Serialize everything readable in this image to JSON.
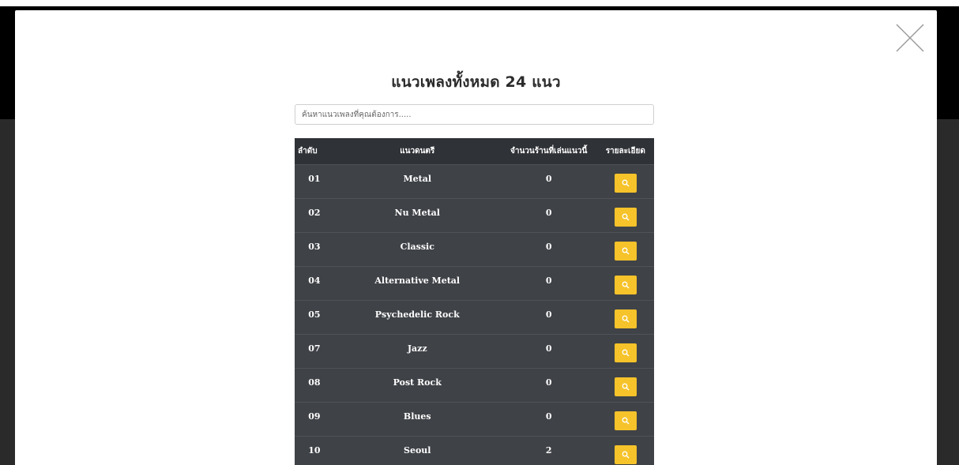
{
  "modal": {
    "title": "แนวเพลงทั้งหมด 24 แนว",
    "search_placeholder": "ค้นหาแนวเพลงที่คุณต้องการ.....",
    "close_icon": "close-icon"
  },
  "table": {
    "headers": {
      "no": "ลำดับ",
      "genre": "แนวดนตรี",
      "count": "จำนวนร้านที่เล่นแนวนี้",
      "detail": "รายละเอียด"
    },
    "rows": [
      {
        "no": "01",
        "genre": "Metal",
        "count": "0"
      },
      {
        "no": "02",
        "genre": "Nu Metal",
        "count": "0"
      },
      {
        "no": "03",
        "genre": "Classic",
        "count": "0"
      },
      {
        "no": "04",
        "genre": "Alternative Metal",
        "count": "0"
      },
      {
        "no": "05",
        "genre": "Psychedelic Rock",
        "count": "0"
      },
      {
        "no": "07",
        "genre": "Jazz",
        "count": "0"
      },
      {
        "no": "08",
        "genre": "Post Rock",
        "count": "0"
      },
      {
        "no": "09",
        "genre": "Blues",
        "count": "0"
      },
      {
        "no": "10",
        "genre": "Seoul",
        "count": "2"
      }
    ],
    "detail_icon": "search-icon"
  },
  "colors": {
    "accent": "#f6c32a",
    "table_bg": "#3f4247",
    "table_header_bg": "#2f3237"
  }
}
